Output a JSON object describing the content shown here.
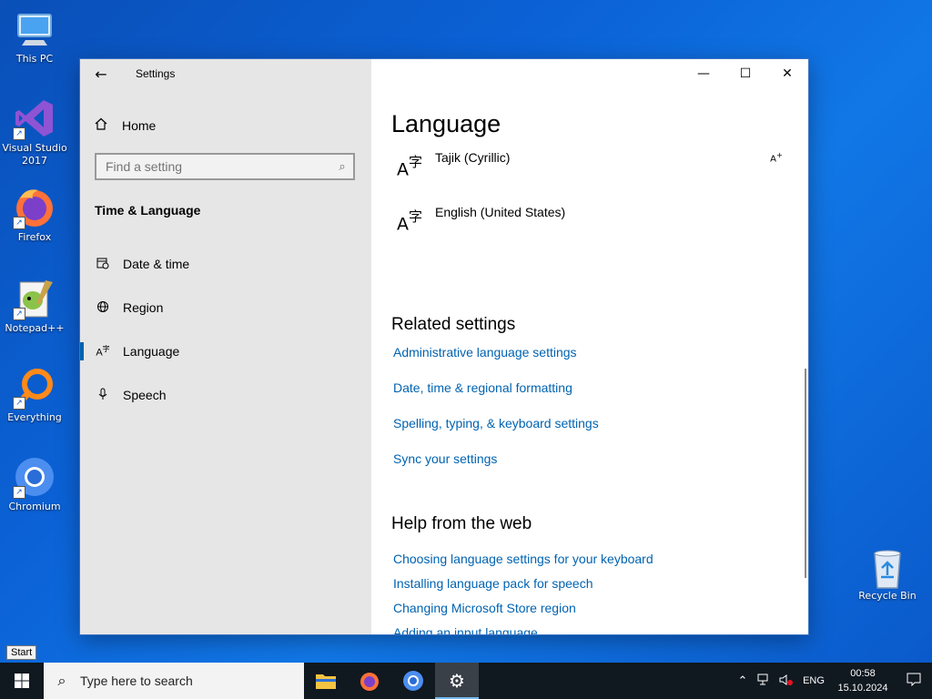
{
  "desktop": {
    "icons": [
      {
        "label": "This PC",
        "icon": "computer-icon"
      },
      {
        "label": "Visual Studio 2017",
        "icon": "visual-studio-icon"
      },
      {
        "label": "Firefox",
        "icon": "firefox-icon"
      },
      {
        "label": "Notepad++",
        "icon": "notepadpp-icon"
      },
      {
        "label": "Everything",
        "icon": "everything-search-icon"
      },
      {
        "label": "Chromium",
        "icon": "chromium-icon"
      }
    ],
    "recycle_bin": {
      "label": "Recycle Bin",
      "icon": "recycle-bin-icon"
    }
  },
  "window": {
    "title": "Settings",
    "controls": {
      "minimize": "—",
      "maximize": "☐",
      "close": "✕"
    },
    "back_glyph": "←"
  },
  "nav": {
    "home": "Home",
    "search_placeholder": "Find a setting",
    "section": "Time & Language",
    "items": [
      {
        "label": "Date & time",
        "icon": "calendar-clock-icon"
      },
      {
        "label": "Region",
        "icon": "globe-icon"
      },
      {
        "label": "Language",
        "icon": "language-icon",
        "active": true
      },
      {
        "label": "Speech",
        "icon": "microphone-icon"
      }
    ]
  },
  "content": {
    "title": "Language",
    "languages": [
      {
        "name": "Tajik (Cyrillic)",
        "has_option": true
      },
      {
        "name": "English (United States)",
        "has_option": false
      }
    ],
    "related_heading": "Related settings",
    "related_links": [
      "Administrative language settings",
      "Date, time & regional formatting",
      "Spelling, typing, & keyboard settings",
      "Sync your settings"
    ],
    "help_heading": "Help from the web",
    "help_links": [
      "Choosing language settings for your keyboard",
      "Installing language pack for speech",
      "Changing Microsoft Store region",
      "Adding an input language"
    ]
  },
  "start_tooltip": "Start",
  "taskbar": {
    "search_placeholder": "Type here to search",
    "apps": [
      {
        "name": "File Explorer",
        "icon": "folder-icon"
      },
      {
        "name": "Firefox",
        "icon": "firefox-icon"
      },
      {
        "name": "Chromium",
        "icon": "chromium-icon"
      },
      {
        "name": "Settings",
        "icon": "gear-icon",
        "active": true
      }
    ],
    "tray": {
      "language": "ENG",
      "time": "00:58",
      "date": "15.10.2024"
    }
  },
  "colors": {
    "accent": "#0063b1",
    "link": "#0063b1",
    "nav_bg": "#e6e6e6",
    "taskbar_bg": "#101820",
    "desktop_bg": "#0b62d6"
  }
}
